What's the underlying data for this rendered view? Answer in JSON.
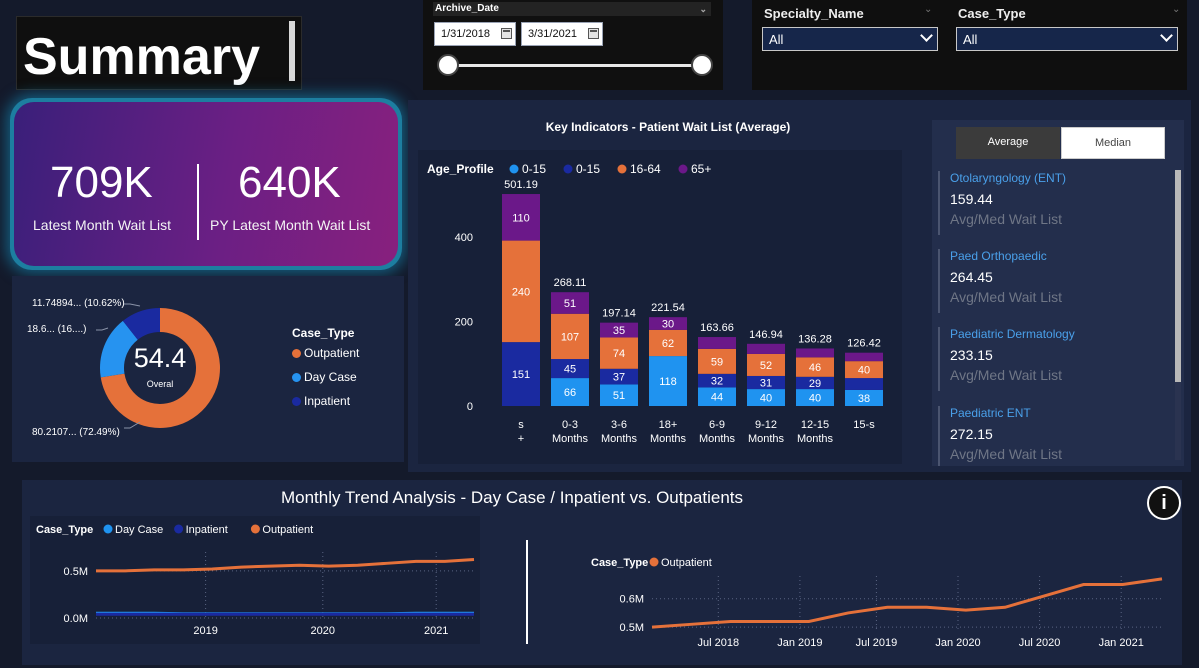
{
  "header": {
    "title": "Summary"
  },
  "date_slicer": {
    "field": "Archive_Date",
    "start": "1/31/2018",
    "end": "3/31/2021"
  },
  "slicers": [
    {
      "label": "Specialty_Name",
      "value": "All"
    },
    {
      "label": "Case_Type",
      "value": "All"
    }
  ],
  "kpi": {
    "latest_value": "709K",
    "latest_label": "Latest Month Wait List",
    "py_value": "640K",
    "py_label": "PY Latest Month Wait List"
  },
  "donut": {
    "center_value": "54.4",
    "center_label": "Overal",
    "legend_title": "Case_Type",
    "legend": [
      "Outpatient",
      "Day Case",
      "Inpatient"
    ],
    "labels": [
      "11.74894... (10.62%)",
      "18.6... (16....)",
      "80.2107... (72.49%)"
    ],
    "colors": [
      "#e5713a",
      "#2693f0",
      "#1a2aa0"
    ],
    "values": [
      72.49,
      16.89,
      10.62
    ]
  },
  "key_indicators": {
    "title": "Key Indicators - Patient Wait List (Average)",
    "legend_title": "Age_Profile",
    "legend": [
      {
        "name": "0-15",
        "color": "#1f93f0"
      },
      {
        "name": "0-15",
        "color": "#1a2aa0"
      },
      {
        "name": "16-64",
        "color": "#e5713a"
      },
      {
        "name": "65+",
        "color": "#6b1889"
      }
    ],
    "toggle": {
      "average": "Average",
      "median": "Median"
    },
    "specialties": [
      {
        "name": "Otolaryngology (ENT)",
        "value": "159.44",
        "sub": "Avg/Med Wait List"
      },
      {
        "name": "Paed Orthopaedic",
        "value": "264.45",
        "sub": "Avg/Med Wait List"
      },
      {
        "name": "Paediatric Dermatology",
        "value": "233.15",
        "sub": "Avg/Med Wait List"
      },
      {
        "name": "Paediatric ENT",
        "value": "272.15",
        "sub": "Avg/Med Wait List"
      }
    ]
  },
  "trend": {
    "title": "Monthly Trend Analysis - Day Case / Inpatient vs. Outpatients",
    "info_icon": "i",
    "left_legend_title": "Case_Type",
    "left_legend": [
      "Day Case",
      "Inpatient",
      "Outpatient"
    ],
    "right_legend_title": "Case_Type",
    "right_legend": [
      "Outpatient"
    ]
  },
  "chart_data": [
    {
      "type": "bar",
      "title": "Key Indicators - Patient Wait List (Average)",
      "categories": [
        "s +",
        "0-3 Months",
        "3-6 Months",
        "18+ Months",
        "6-9 Months",
        "9-12 Months",
        "12-15 Months",
        "15-s"
      ],
      "series": [
        {
          "name": "0-15",
          "values": [
            0,
            66,
            51,
            118,
            44,
            40,
            40,
            38
          ],
          "color": "#1f93f0"
        },
        {
          "name": "0-15",
          "values": [
            151,
            45,
            37,
            0,
            32,
            31,
            29,
            28
          ],
          "color": "#1a2aa0"
        },
        {
          "name": "16-64",
          "values": [
            240,
            107,
            74,
            62,
            59,
            52,
            46,
            40
          ],
          "color": "#e5713a"
        },
        {
          "name": "65+",
          "values": [
            110,
            51,
            35,
            30,
            28,
            24,
            21,
            20
          ],
          "color": "#6b1889"
        }
      ],
      "totals": [
        "501.19",
        "268.11",
        "197.14",
        "221.54",
        "163.66",
        "146.94",
        "136.28",
        "126.42"
      ],
      "ylim": [
        0,
        520
      ],
      "yticks": [
        "0",
        "200",
        "400"
      ]
    },
    {
      "type": "line",
      "x": [
        "2018-01",
        "2018-04",
        "2018-07",
        "2018-10",
        "2019-01",
        "2019-04",
        "2019-07",
        "2019-10",
        "2020-01",
        "2020-04",
        "2020-07",
        "2020-10",
        "2021-01",
        "2021-03"
      ],
      "series": [
        {
          "name": "Outpatient",
          "values": [
            0.5,
            0.5,
            0.51,
            0.51,
            0.52,
            0.54,
            0.55,
            0.56,
            0.55,
            0.56,
            0.58,
            0.6,
            0.6,
            0.62
          ],
          "color": "#e5713a"
        },
        {
          "name": "Day Case",
          "values": [
            0.05,
            0.05,
            0.05,
            0.045,
            0.045,
            0.045,
            0.045,
            0.045,
            0.045,
            0.045,
            0.045,
            0.05,
            0.05,
            0.05
          ],
          "color": "#1f93f0"
        },
        {
          "name": "Inpatient",
          "values": [
            0.04,
            0.04,
            0.04,
            0.04,
            0.04,
            0.04,
            0.04,
            0.04,
            0.04,
            0.04,
            0.04,
            0.04,
            0.04,
            0.04
          ],
          "color": "#1a2aa0"
        }
      ],
      "xticks": [
        "2019",
        "2020",
        "2021"
      ],
      "yticks": [
        "0.0M",
        "0.5M"
      ],
      "ylim": [
        0,
        0.7
      ]
    },
    {
      "type": "line",
      "x": [
        "2018-01",
        "2018-04",
        "2018-07",
        "2018-10",
        "2019-01",
        "2019-04",
        "2019-07",
        "2019-10",
        "2020-01",
        "2020-04",
        "2020-07",
        "2020-10",
        "2021-01",
        "2021-03"
      ],
      "series": [
        {
          "name": "Outpatient",
          "values": [
            0.5,
            0.51,
            0.52,
            0.52,
            0.52,
            0.55,
            0.57,
            0.57,
            0.56,
            0.57,
            0.61,
            0.65,
            0.65,
            0.67
          ],
          "color": "#e5713a"
        }
      ],
      "xticks": [
        "Jul 2018",
        "Jan 2019",
        "Jul 2019",
        "Jan 2020",
        "Jul 2020",
        "Jan 2021"
      ],
      "yticks": [
        "0.5M",
        "0.6M"
      ],
      "ylim": [
        0.49,
        0.68
      ]
    }
  ]
}
